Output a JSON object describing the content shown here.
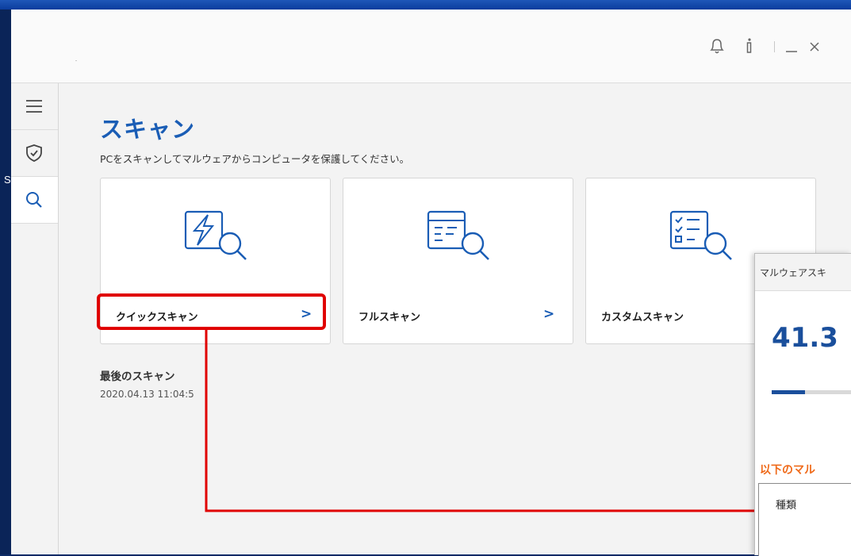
{
  "desktop": {
    "edge_char": "S"
  },
  "header": {
    "icons": [
      "bell-icon",
      "info-icon",
      "minimize-icon",
      "close-icon"
    ]
  },
  "sidebar": {
    "items": [
      {
        "icon": "menu-icon",
        "active": false
      },
      {
        "icon": "shield-check-icon",
        "active": false
      },
      {
        "icon": "search-icon",
        "active": true
      }
    ]
  },
  "main": {
    "title": "スキャン",
    "subtitle": "PCをスキャンしてマルウェアからコンピュータを保護してください。",
    "cards": [
      {
        "label": "クイックスキャン",
        "icon": "quick-scan-icon"
      },
      {
        "label": "フルスキャン",
        "icon": "full-scan-icon"
      },
      {
        "label": "カスタムスキャン",
        "icon": "custom-scan-icon"
      }
    ],
    "last_scan_label": "最後のスキャン",
    "last_scan_date": "2020.04.13 11:04:5"
  },
  "dialog": {
    "title": "マルウェアスキ",
    "percent": "41.3",
    "progress": 0.413,
    "found_label": "以下のマル",
    "column_header": "種類"
  },
  "colors": {
    "accent": "#1a5db5",
    "annotation": "#e00000",
    "warning": "#ef6a1a",
    "desktop": "#0d2a66"
  }
}
